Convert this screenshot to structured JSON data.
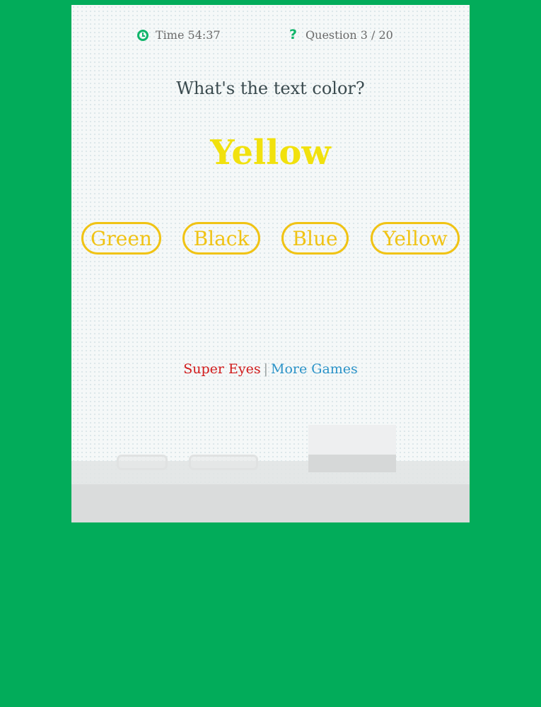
{
  "status": {
    "time_label": "Time 54:37",
    "question_label": "Question 3 / 20",
    "clock_icon": "clock-icon",
    "question_icon": "question-mark-icon",
    "question_icon_glyph": "?",
    "icon_color": "#10b56a"
  },
  "question": {
    "prompt": "What's the text color?",
    "word": "Yellow",
    "word_color": "#f1e10d"
  },
  "answers": [
    {
      "label": "Green"
    },
    {
      "label": "Black"
    },
    {
      "label": "Blue"
    },
    {
      "label": "Yellow"
    }
  ],
  "answer_color": "#f0c314",
  "footer": {
    "super_eyes": "Super Eyes",
    "separator": "|",
    "more_games": "More Games"
  },
  "colors": {
    "background": "#02ac5a",
    "card": "#f5f8f8",
    "super_eyes": "#d11a1a",
    "more_games": "#2b93c8"
  }
}
